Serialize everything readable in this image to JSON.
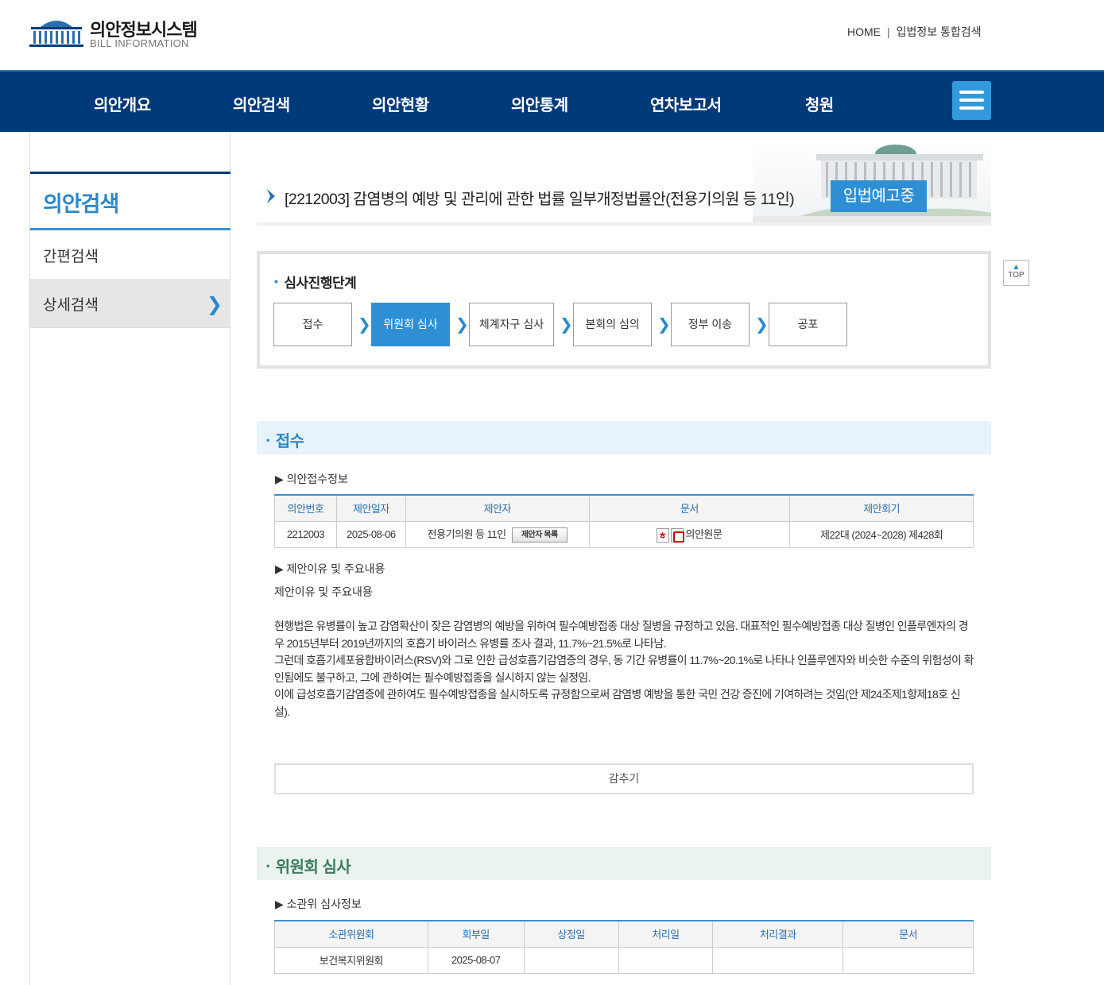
{
  "header": {
    "logo_title": "의안정보시스템",
    "logo_subtitle": "BILL INFORMATION",
    "util_home": "HOME",
    "util_sep": "|",
    "util_search": "입법정보 통합검색"
  },
  "nav": {
    "items": [
      "의안개요",
      "의안검색",
      "의안현황",
      "의안통계",
      "연차보고서",
      "청원"
    ],
    "menu_icon": "hamburger-icon"
  },
  "sidebar": {
    "title": "의안검색",
    "items": [
      {
        "label": "간편검색",
        "active": false
      },
      {
        "label": "상세검색",
        "active": true
      }
    ]
  },
  "bill": {
    "title": "[2212003] 감염병의 예방 및 관리에 관한 법률 일부개정법률안(전용기의원 등 11인)",
    "badge": "입법예고중"
  },
  "stages": {
    "title": "심사진행단계",
    "steps": [
      {
        "label": "접수",
        "active": false
      },
      {
        "label": "위원회 심사",
        "active": true
      },
      {
        "label": "체계자구 심사",
        "active": false
      },
      {
        "label": "본회의 심의",
        "active": false
      },
      {
        "label": "정부 이송",
        "active": false
      },
      {
        "label": "공포",
        "active": false
      }
    ]
  },
  "receipt": {
    "section_title": "접수",
    "info_title": "▶ 의안접수정보",
    "columns": [
      "의안번호",
      "제안일자",
      "제안자",
      "문서",
      "제안회기"
    ],
    "row": {
      "bill_no": "2212003",
      "date": "2025-08-06",
      "proposer": "전용기의원 등 11인",
      "proposer_btn": "제안자 목록",
      "doc": "의안원문",
      "session": "제22대 (2024~2028) 제428회"
    },
    "reason_title": "▶ 제안이유 및 주요내용",
    "reason_head": "제안이유 및 주요내용",
    "reason_paragraphs": [
      "현행법은 유병률이 높고 감염확산이 잦은 감염병의 예방을 위하여 필수예방접종 대상 질병을 규정하고 있음. 대표적인 필수예방접종 대상 질병인 인플루엔자의 경우 2015년부터 2019년까지의 호흡기 바이러스 유병률 조사 결과, 11.7%~21.5%로 나타남.",
      "그런데 호흡기세포융합바이러스(RSV)와 그로 인한 급성호흡기감염증의 경우, 동 기간 유병률이 11.7%~20.1%로 나타나 인플루엔자와 비슷한 수준의 위험성이 확인됨에도 불구하고, 그에 관하여는 필수예방접종을 실시하지 않는 실정임.",
      "이에 급성호흡기감염증에 관하여도 필수예방접종을 실시하도록 규정함으로써 감염병 예방을 통한 국민 건강 증진에 기여하려는 것임(안 제24조제1항제18호 신설)."
    ],
    "hide_label": "감추기"
  },
  "committee": {
    "section_title": "위원회 심사",
    "info_title": "▶ 소관위 심사정보",
    "columns": [
      "소관위원회",
      "회부일",
      "상정일",
      "처리일",
      "처리결과",
      "문서"
    ],
    "row": {
      "committee": "보건복지위원회",
      "referral_date": "2025-08-07",
      "agenda_date": "",
      "process_date": "",
      "result": "",
      "doc": ""
    }
  },
  "top_button": "TOP",
  "colors": {
    "nav_bg": "#003a78",
    "accent": "#2f8fd4"
  }
}
